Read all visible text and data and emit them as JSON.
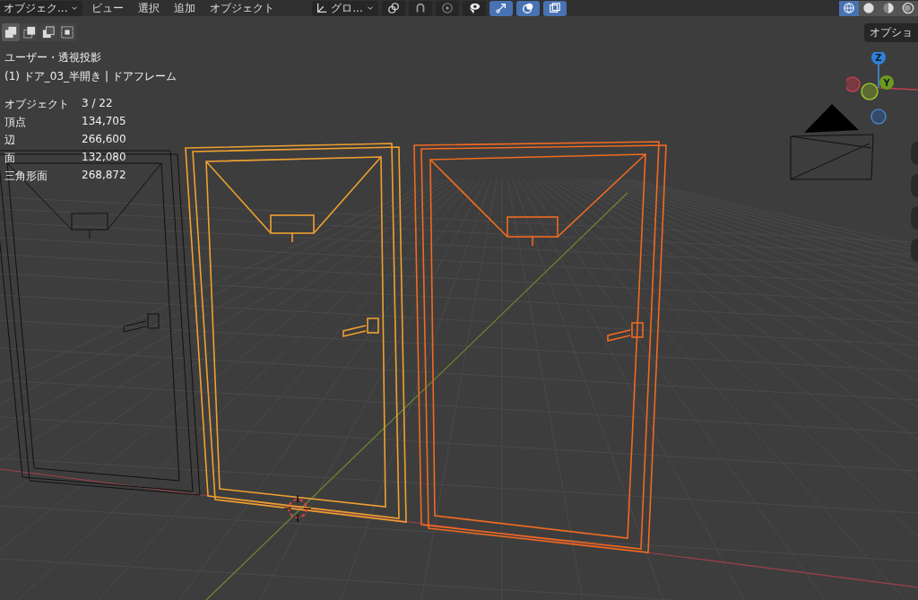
{
  "header": {
    "mode": {
      "label": "オブジェク..."
    },
    "menus": [
      "ビュー",
      "選択",
      "追加",
      "オブジェクト"
    ],
    "orientation": {
      "label": "グロ..."
    },
    "toggles": [
      {
        "kind": "pivot",
        "on": false
      },
      {
        "kind": "snap",
        "on": false
      },
      {
        "kind": "proportional",
        "on": false
      },
      {
        "kind": "visibility",
        "on": false
      },
      {
        "kind": "gizmo",
        "on": true
      },
      {
        "kind": "overlay",
        "on": true
      },
      {
        "kind": "xray",
        "on": true
      }
    ],
    "shading": [
      {
        "kind": "wireframe",
        "selected": true
      },
      {
        "kind": "solid",
        "selected": false
      },
      {
        "kind": "material",
        "selected": false
      },
      {
        "kind": "rendered",
        "selected": false
      }
    ]
  },
  "select_modes": [
    {
      "kind": "new",
      "selected": true
    },
    {
      "kind": "extend",
      "selected": false
    },
    {
      "kind": "subtract",
      "selected": false
    },
    {
      "kind": "intersect",
      "selected": false
    }
  ],
  "options_button": "オプショ",
  "overlay": {
    "view_name": "ユーザー・透視投影",
    "object_name": "(1) ドア_03_半開き | ドアフレーム",
    "stats": [
      {
        "label": "オブジェクト",
        "value": "3 / 22"
      },
      {
        "label": "頂点",
        "value": "134,705"
      },
      {
        "label": "辺",
        "value": "266,600"
      },
      {
        "label": "面",
        "value": "132,080"
      },
      {
        "label": "三角形面",
        "value": "268,872"
      }
    ]
  },
  "gizmo": {
    "axes": [
      {
        "label": "Z",
        "color": "#2f80d8"
      },
      {
        "label": "Y",
        "color": "#6e9a1e"
      }
    ]
  },
  "doors": [
    {
      "selected": false,
      "color": "#111111"
    },
    {
      "selected": true,
      "color": "#f0a030"
    },
    {
      "selected": true,
      "color": "#f06a20"
    }
  ]
}
